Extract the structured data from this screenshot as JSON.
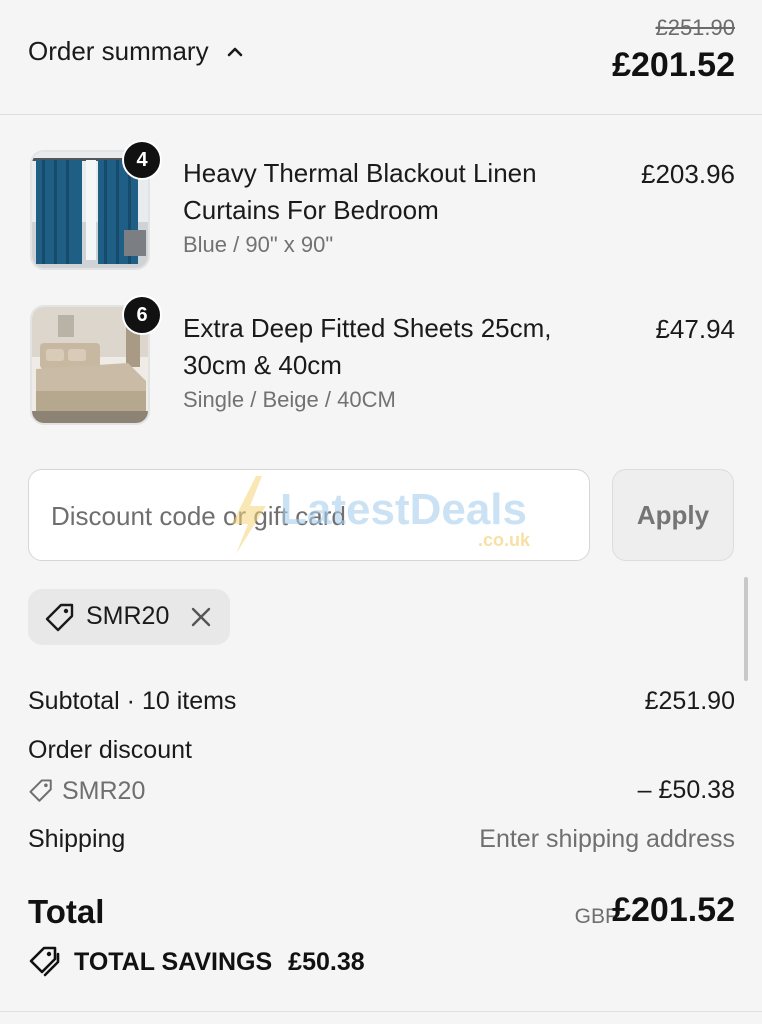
{
  "header": {
    "title": "Order summary",
    "original_price": "£251.90",
    "total_price": "£201.52"
  },
  "items": [
    {
      "name": "Heavy Thermal Blackout Linen Curtains For Bedroom",
      "variant": "Blue / 90\" x 90\"",
      "price": "£203.96",
      "quantity": "4",
      "image_icon": "blue-curtains-image"
    },
    {
      "name": "Extra Deep Fitted Sheets 25cm, 30cm & 40cm",
      "variant": "Single / Beige / 40CM",
      "price": "£47.94",
      "quantity": "6",
      "image_icon": "beige-bed-sheet-image"
    }
  ],
  "discount": {
    "placeholder": "Discount code or gift card",
    "apply_label": "Apply",
    "applied_code": "SMR20"
  },
  "watermark": {
    "brand": "LatestDeals",
    "suffix": ".co.uk"
  },
  "summary": {
    "subtotal_label": "Subtotal · 10 items",
    "subtotal_value": "£251.90",
    "order_discount_label": "Order discount",
    "discount_code": "SMR20",
    "discount_value": "– £50.38",
    "shipping_label": "Shipping",
    "shipping_value": "Enter shipping address",
    "total_label": "Total",
    "currency": "GBP",
    "total_value": "£201.52",
    "savings_label": "TOTAL SAVINGS",
    "savings_value": "£50.38"
  },
  "colors": {
    "background": "#f5f5f5",
    "text": "#1a1a1a",
    "muted": "#6f6f6f",
    "badge": "#111111"
  }
}
